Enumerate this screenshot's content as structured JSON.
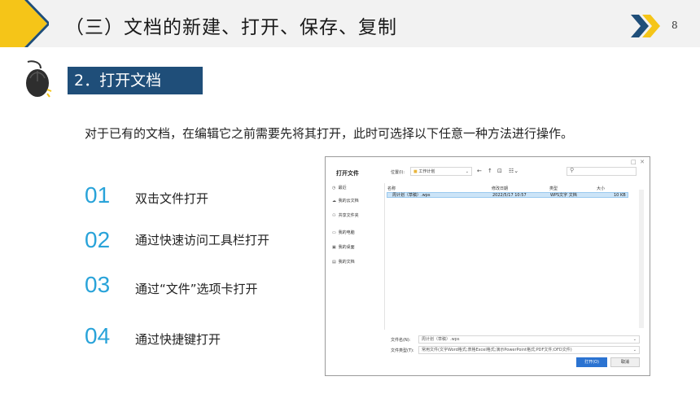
{
  "header": {
    "title": "（三）文档的新建、打开、保存、复制",
    "page_number": "8"
  },
  "section": {
    "tag": "2．打开文档"
  },
  "intro": "对于已有的文档，在编辑它之前需要先将其打开，此时可选择以下任意一种方法进行操作。",
  "steps": [
    {
      "num": "01",
      "label": "双击文件打开"
    },
    {
      "num": "02",
      "label": "通过快速访问工具栏打开"
    },
    {
      "num": "03",
      "label": "通过“文件”选项卡打开"
    },
    {
      "num": "04",
      "label": "通过快捷键打开"
    }
  ],
  "dialog": {
    "title": "打开文件",
    "location_label": "位置(I):",
    "location_value": "工作计划",
    "nav": [
      {
        "icon": "clock-icon",
        "label": "最近"
      },
      {
        "icon": "cloud-icon",
        "label": "我的云文档"
      },
      {
        "icon": "share-icon",
        "label": "共享文件夹"
      },
      {
        "icon": "computer-icon",
        "label": "我的电脑"
      },
      {
        "icon": "desktop-icon",
        "label": "我的桌面"
      },
      {
        "icon": "documents-icon",
        "label": "我的文档"
      }
    ],
    "columns": [
      "名称",
      "修改日期",
      "类型",
      "大小"
    ],
    "files": [
      {
        "name": "周计划（草稿）.wps",
        "date": "2022/5/17 10:57",
        "type": "WPS文字 文档",
        "size": "10 KB"
      }
    ],
    "filename_label": "文件名(N):",
    "filename_value": "周计划（草稿）.wps",
    "filetype_label": "文件类型(T):",
    "filetype_value": "常用文件(文字Word格式;表格Excel格式;演示PowerPoint格式;PDF文件;OFD文件)",
    "open_button": "打开(O)",
    "cancel_button": "取消"
  },
  "colors": {
    "accent": "#29a3d9",
    "brand_navy": "#1f4e79",
    "yellow": "#f5c518",
    "button_blue": "#2b73d1"
  }
}
